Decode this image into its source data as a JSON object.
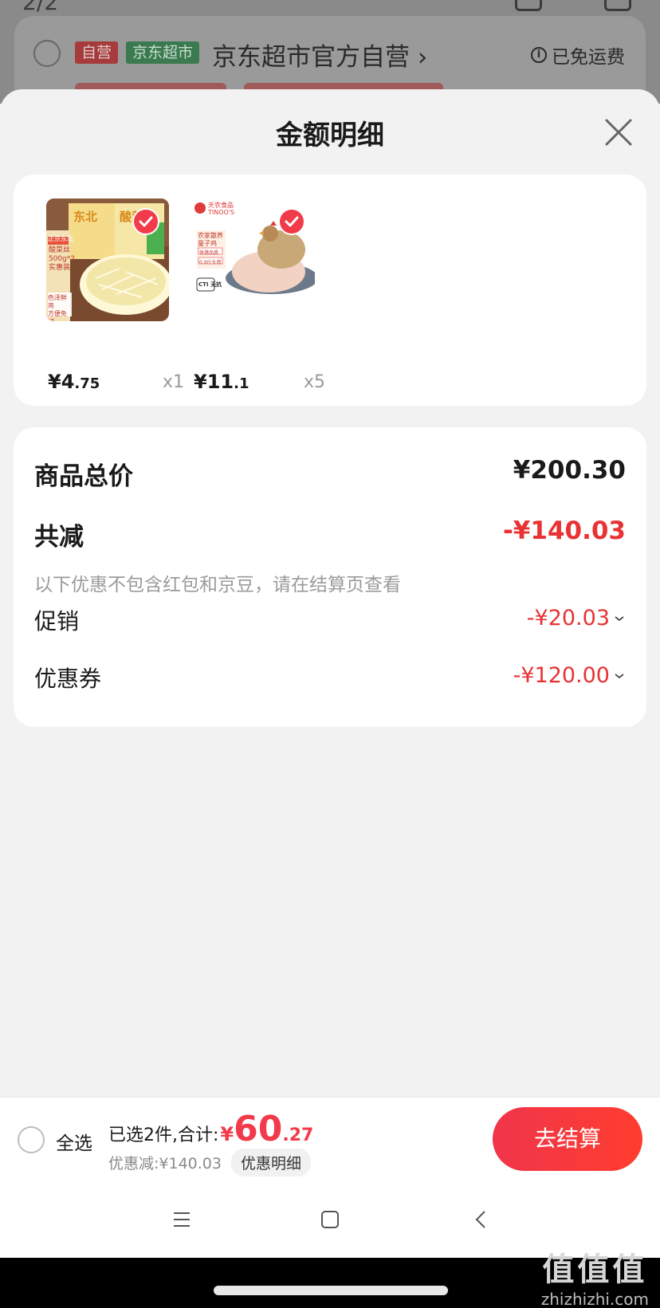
{
  "background": {
    "pager": "2/2",
    "self_tag": "自营",
    "store_tag": "京东超市",
    "store_name": "京东超市官方自营",
    "store_chevron": "›",
    "shipping": "已免运费"
  },
  "sheet": {
    "title": "金额明细"
  },
  "products": [
    {
      "price_int": "¥4",
      "price_dec": ".75",
      "qty": "x1",
      "image_text": {
        "brand": "正京东北",
        "line1": "酸菜丝",
        "line2": "东北",
        "line3": "酸菜",
        "line4": "500g*2",
        "line5": "实惠装",
        "line6": "色泽鲜亮",
        "line7": "方便免切"
      }
    },
    {
      "price_int": "¥11",
      "price_dec": ".1",
      "qty": "x5",
      "image_text": {
        "brand": "天农食品",
        "brand_en": "TINOO'S",
        "line1": "农家散养",
        "line2": "童子鸡",
        "line3": "供港品质",
        "line4": "0.9斤头鸡",
        "line5": "CTI",
        "line6": "无抗"
      }
    }
  ],
  "summary": {
    "total_label": "商品总价",
    "total_value": "¥200.30",
    "reduce_label": "共减",
    "reduce_value": "-¥140.03",
    "note": "以下优惠不包含红包和京豆，请在结算页查看",
    "promo_label": "促销",
    "promo_value": "-¥20.03",
    "coupon_label": "优惠券",
    "coupon_value": "-¥120.00"
  },
  "bottom": {
    "select_all": "全选",
    "selected_text": "已选2件,合计:",
    "yen": "¥",
    "total_int": "60",
    "total_dec": ".27",
    "discount_text": "优惠减:¥140.03",
    "detail_button": "优惠明细",
    "checkout": "去结算"
  },
  "watermark": {
    "big": "值值值",
    "small": "zhizhizhi.com"
  },
  "colors": {
    "accent_red": "#f23b4a",
    "discount_red": "#e83234",
    "store_green": "#3b7a4f"
  }
}
